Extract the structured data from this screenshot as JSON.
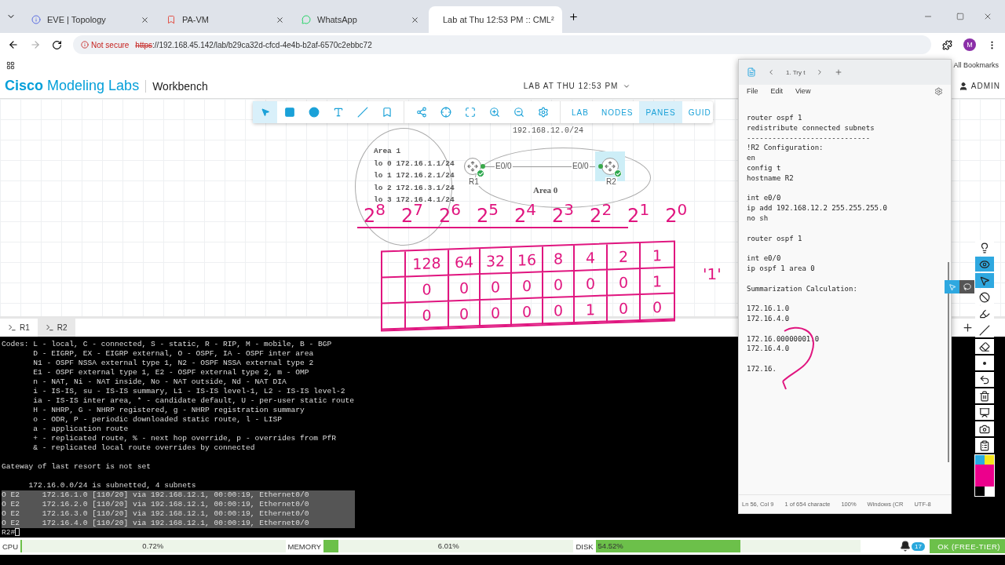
{
  "browser": {
    "tabs": [
      {
        "title": "EVE | Topology",
        "selected": false
      },
      {
        "title": "PA-VM",
        "selected": false
      },
      {
        "title": "WhatsApp",
        "selected": false
      },
      {
        "title": "Lab at Thu 12:53 PM :: CML²",
        "selected": true
      }
    ],
    "security": "Not secure",
    "scheme": "https",
    "address": "://192.168.45.142/lab/b29ca32d-cfcd-4e4b-b2af-6570c2ebbc72",
    "profile": "M",
    "bookmarks": "All Bookmarks"
  },
  "app": {
    "brand_bold": "Cisco",
    "brand": "Modeling Labs",
    "section": "Workbench",
    "lab_title": "LAB AT THU 12:53 PM",
    "user": "ADMIN"
  },
  "toolbar": {
    "tools": [
      {
        "kind": "pointer",
        "selected": true
      },
      {
        "kind": "rectangle",
        "selected": false
      },
      {
        "kind": "ellipse",
        "selected": false
      },
      {
        "kind": "text",
        "selected": false
      },
      {
        "kind": "line",
        "selected": false
      },
      {
        "kind": "annotate",
        "selected": false
      },
      {
        "kind": "layout",
        "selected": false
      },
      {
        "kind": "center",
        "selected": false
      },
      {
        "kind": "fit",
        "selected": false
      },
      {
        "kind": "zoom-in",
        "selected": false
      },
      {
        "kind": "zoom-out",
        "selected": false
      },
      {
        "kind": "settings",
        "selected": false
      }
    ],
    "menus": [
      {
        "label": "LAB",
        "selected": false
      },
      {
        "label": "NODES",
        "selected": false
      },
      {
        "label": "PANES",
        "selected": true
      },
      {
        "label": "GUID",
        "selected": false
      }
    ]
  },
  "topology": {
    "network": "192.168.12.0/24",
    "note_lines": [
      "Area 1",
      "lo 0 172.16.1.1/24",
      "lo 1 172.16.2.1/24",
      "lo 2 172.16.3.1/24",
      "lo 3 172.16.4.1/24"
    ],
    "area_label": "Area 0",
    "nodes": [
      {
        "name": "R1",
        "interface": "E0/0",
        "selected": false,
        "running": true
      },
      {
        "name": "R2",
        "interface": "E0/0",
        "selected": true,
        "running": true
      }
    ]
  },
  "annotations": {
    "powers": [
      "2$^{8}$",
      "2$^{7}$",
      "2$^{6}$",
      "2$^{5}$",
      "2$^{4}$",
      "2$^{3}$",
      "2$^{2}$",
      "2$^{1}$",
      "2$^{0}$"
    ],
    "place_values": [
      "128",
      "64",
      "32",
      "16",
      "8",
      "4",
      "2",
      "1"
    ],
    "rows": [
      [
        "0",
        "0",
        "0",
        "0",
        "0",
        "0",
        "0",
        "1"
      ],
      [
        "0",
        "0",
        "0",
        "0",
        "0",
        "1",
        "0",
        "0"
      ]
    ],
    "side_note": "'1'"
  },
  "console": {
    "tabs": [
      {
        "label": "R1",
        "selected": false
      },
      {
        "label": "R2",
        "selected": true
      }
    ],
    "blocks": [
      [
        {
          "text": "Codes: L - local, C - connected, S - static, R - RIP, M - mobile, B - BGP",
          "selected": false
        },
        {
          "text": "       D - EIGRP, EX - EIGRP external, O - OSPF, IA - OSPF inter area",
          "selected": false
        },
        {
          "text": "       N1 - OSPF NSSA external type 1, N2 - OSPF NSSA external type 2",
          "selected": false
        },
        {
          "text": "       E1 - OSPF external type 1, E2 - OSPF external type 2, m - OMP",
          "selected": false
        },
        {
          "text": "       n - NAT, Ni - NAT inside, No - NAT outside, Nd - NAT DIA",
          "selected": false
        },
        {
          "text": "       i - IS-IS, su - IS-IS summary, L1 - IS-IS level-1, L2 - IS-IS level-2",
          "selected": false
        },
        {
          "text": "       ia - IS-IS inter area, * - candidate default, U - per-user static route",
          "selected": false
        },
        {
          "text": "       H - NHRP, G - NHRP registered, g - NHRP registration summary",
          "selected": false
        },
        {
          "text": "       o - ODR, P - periodic downloaded static route, l - LISP",
          "selected": false
        },
        {
          "text": "       a - application route",
          "selected": false
        },
        {
          "text": "       + - replicated route, % - next hop override, p - overrides from PfR",
          "selected": false
        },
        {
          "text": "       & - replicated local route overrides by connected",
          "selected": false
        }
      ],
      [
        {
          "text": "Gateway of last resort is not set",
          "selected": false
        }
      ],
      [
        {
          "text": "      172.16.0.0/24 is subnetted, 4 subnets",
          "selected": false
        },
        {
          "text": "O E2     172.16.1.0 [110/20] via 192.168.12.1, 00:00:19, Ethernet0/0",
          "selected": true
        },
        {
          "text": "O E2     172.16.2.0 [110/20] via 192.168.12.1, 00:00:19, Ethernet0/0",
          "selected": true
        },
        {
          "text": "O E2     172.16.3.0 [110/20] via 192.168.12.1, 00:00:19, Ethernet0/0",
          "selected": true
        },
        {
          "text": "O E2     172.16.4.0 [110/20] via 192.168.12.1, 00:00:19, Ethernet0/0",
          "selected": true
        },
        {
          "text": "R2#",
          "selected": false
        }
      ]
    ]
  },
  "status": {
    "meters": [
      {
        "label": "CPU",
        "reading": "0.72%",
        "level": 0.0072
      },
      {
        "label": "MEMORY",
        "reading": "6.01%",
        "level": 0.0601
      },
      {
        "label": "DISK",
        "reading": "54.52%",
        "level": 0.5452
      }
    ],
    "notifications": "17",
    "license": "OK (FREE-TIER)"
  },
  "notepad": {
    "tab": "1. Try t",
    "menus": [
      "File",
      "Edit",
      "View"
    ],
    "paragraphs": [
      [
        "router ospf 1",
        "redistribute connected subnets",
        "-----------------------------",
        "!R2 Configuration:",
        "en",
        "config t",
        "hostname R2"
      ],
      [
        "int e0/0",
        "ip add 192.168.12.2 255.255.255.0",
        "no sh"
      ],
      [
        "router ospf 1"
      ],
      [
        "int e0/0",
        "ip ospf 1 area 0"
      ],
      [
        "Summarization Calculation:"
      ],
      [
        "172.16.1.0",
        "172.16.4.0"
      ],
      [
        "172.16.00000001.0",
        "172.16.4.0"
      ],
      [
        "172.16."
      ]
    ],
    "status": [
      "Ln 56, Col 9",
      "1 of 654 characte",
      "100%",
      "Windows (CR",
      "UTF-8"
    ]
  },
  "pen_toolbar": {
    "tools": [
      {
        "kind": "spotlight",
        "selected": false
      },
      {
        "kind": "eye",
        "selected": true
      },
      {
        "kind": "pointer",
        "selected": true
      },
      {
        "kind": "no-draw",
        "selected": false
      },
      {
        "kind": "highlighter",
        "selected": false
      },
      {
        "kind": "line",
        "selected": false
      },
      {
        "kind": "eraser",
        "selected": false
      },
      {
        "kind": "dot",
        "selected": false
      },
      {
        "kind": "undo",
        "selected": false
      },
      {
        "kind": "trash",
        "selected": false
      },
      {
        "kind": "board",
        "selected": false
      },
      {
        "kind": "camera",
        "selected": false
      },
      {
        "kind": "clipboard",
        "selected": false
      }
    ],
    "colors": [
      {
        "color": "#29abe2",
        "selected": false
      },
      {
        "color": "#f7e51d",
        "selected": false
      },
      {
        "color": "#ec008c",
        "selected": true
      },
      {
        "color": "#000000",
        "selected": false
      }
    ]
  }
}
